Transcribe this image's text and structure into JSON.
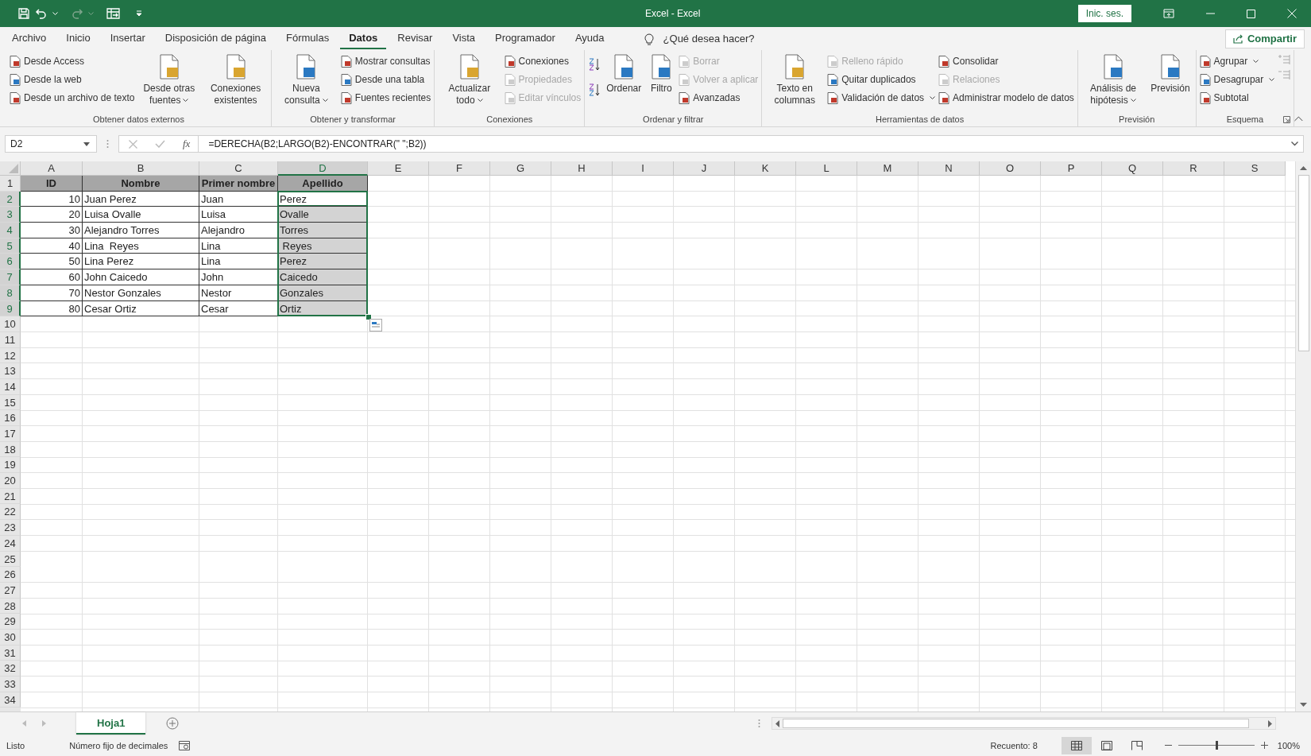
{
  "window": {
    "title": "Excel - Excel",
    "sign_in": "Inic. ses."
  },
  "menu_tabs": [
    {
      "label": "Archivo",
      "selected": false
    },
    {
      "label": "Inicio",
      "selected": false
    },
    {
      "label": "Insertar",
      "selected": false
    },
    {
      "label": "Disposición de página",
      "selected": false
    },
    {
      "label": "Fórmulas",
      "selected": false
    },
    {
      "label": "Datos",
      "selected": true
    },
    {
      "label": "Revisar",
      "selected": false
    },
    {
      "label": "Vista",
      "selected": false
    },
    {
      "label": "Programador",
      "selected": false
    },
    {
      "label": "Ayuda",
      "selected": false
    }
  ],
  "tell_me": "¿Qué desea hacer?",
  "share": "Compartir",
  "ribbon_groups": [
    {
      "label": "Obtener datos externos",
      "columns": [
        {
          "kind": "stack",
          "items": [
            {
              "label": "Desde Access",
              "disabled": false,
              "dropdown": false
            },
            {
              "label": "Desde la web",
              "disabled": false,
              "dropdown": false
            },
            {
              "label": "Desde un archivo de texto",
              "disabled": false,
              "dropdown": false
            }
          ]
        },
        {
          "kind": "large",
          "label": "Desde otras fuentes",
          "disabled": false,
          "dropdown": true
        },
        {
          "kind": "large",
          "label": "Conexiones existentes",
          "disabled": false,
          "dropdown": false
        }
      ]
    },
    {
      "label": "Obtener y transformar",
      "columns": [
        {
          "kind": "large",
          "label": "Nueva consulta",
          "disabled": false,
          "dropdown": true
        },
        {
          "kind": "stack",
          "items": [
            {
              "label": "Mostrar consultas",
              "disabled": false,
              "dropdown": false
            },
            {
              "label": "Desde una tabla",
              "disabled": false,
              "dropdown": false
            },
            {
              "label": "Fuentes recientes",
              "disabled": false,
              "dropdown": false
            }
          ]
        }
      ]
    },
    {
      "label": "Conexiones",
      "columns": [
        {
          "kind": "large",
          "label": "Actualizar todo",
          "disabled": false,
          "dropdown": true
        },
        {
          "kind": "stack",
          "items": [
            {
              "label": "Conexiones",
              "disabled": false,
              "dropdown": false
            },
            {
              "label": "Propiedades",
              "disabled": true,
              "dropdown": false
            },
            {
              "label": "Editar vínculos",
              "disabled": true,
              "dropdown": false
            }
          ]
        }
      ]
    },
    {
      "label": "Ordenar y filtrar",
      "columns": [
        {
          "kind": "sort"
        },
        {
          "kind": "large",
          "label": "Ordenar",
          "disabled": false,
          "dropdown": false
        },
        {
          "kind": "large",
          "label": "Filtro",
          "disabled": false,
          "dropdown": false
        },
        {
          "kind": "stack",
          "items": [
            {
              "label": "Borrar",
              "disabled": true,
              "dropdown": false
            },
            {
              "label": "Volver a aplicar",
              "disabled": true,
              "dropdown": false
            },
            {
              "label": "Avanzadas",
              "disabled": false,
              "dropdown": false
            }
          ]
        }
      ]
    },
    {
      "label": "Herramientas de datos",
      "columns": [
        {
          "kind": "large",
          "label": "Texto en columnas",
          "disabled": false,
          "dropdown": false
        },
        {
          "kind": "stack",
          "items": [
            {
              "label": "Relleno rápido",
              "disabled": true,
              "dropdown": false
            },
            {
              "label": "Quitar duplicados",
              "disabled": false,
              "dropdown": false
            },
            {
              "label": "Validación de datos",
              "disabled": false,
              "dropdown": true
            }
          ]
        },
        {
          "kind": "stack",
          "items": [
            {
              "label": "Consolidar",
              "disabled": false,
              "dropdown": false
            },
            {
              "label": "Relaciones",
              "disabled": true,
              "dropdown": false
            },
            {
              "label": "Administrar modelo de datos",
              "disabled": false,
              "dropdown": false
            }
          ]
        }
      ]
    },
    {
      "label": "Previsión",
      "columns": [
        {
          "kind": "large",
          "label": "Análisis de hipótesis",
          "disabled": false,
          "dropdown": true
        },
        {
          "kind": "large",
          "label": "Previsión",
          "disabled": false,
          "dropdown": false
        }
      ]
    },
    {
      "label": "Esquema",
      "launcher": true,
      "columns": [
        {
          "kind": "stack",
          "items": [
            {
              "label": "Agrupar",
              "disabled": false,
              "dropdown": true
            },
            {
              "label": "Desagrupar",
              "disabled": false,
              "dropdown": true
            },
            {
              "label": "Subtotal",
              "disabled": false,
              "dropdown": false
            }
          ]
        },
        {
          "kind": "outline"
        }
      ]
    }
  ],
  "formula_bar": {
    "name_box": "D2",
    "function_label": "fx",
    "formula": "=DERECHA(B2;LARGO(B2)-ENCONTRAR(\" \";B2))"
  },
  "grid": {
    "columns": [
      {
        "label": "A",
        "selected": false
      },
      {
        "label": "B",
        "selected": false
      },
      {
        "label": "C",
        "selected": false
      },
      {
        "label": "D",
        "selected": true
      },
      {
        "label": "E",
        "selected": false
      },
      {
        "label": "F",
        "selected": false
      },
      {
        "label": "G",
        "selected": false
      },
      {
        "label": "H",
        "selected": false
      },
      {
        "label": "I",
        "selected": false
      },
      {
        "label": "J",
        "selected": false
      },
      {
        "label": "K",
        "selected": false
      },
      {
        "label": "L",
        "selected": false
      },
      {
        "label": "M",
        "selected": false
      },
      {
        "label": "N",
        "selected": false
      },
      {
        "label": "O",
        "selected": false
      },
      {
        "label": "P",
        "selected": false
      },
      {
        "label": "Q",
        "selected": false
      },
      {
        "label": "R",
        "selected": false
      },
      {
        "label": "S",
        "selected": false
      }
    ],
    "row_numbers": [
      {
        "label": "1",
        "selected": false
      },
      {
        "label": "2",
        "selected": true
      },
      {
        "label": "3",
        "selected": true
      },
      {
        "label": "4",
        "selected": true
      },
      {
        "label": "5",
        "selected": true
      },
      {
        "label": "6",
        "selected": true
      },
      {
        "label": "7",
        "selected": true
      },
      {
        "label": "8",
        "selected": true
      },
      {
        "label": "9",
        "selected": true
      },
      {
        "label": "10",
        "selected": false
      },
      {
        "label": "11",
        "selected": false
      },
      {
        "label": "12",
        "selected": false
      },
      {
        "label": "13",
        "selected": false
      },
      {
        "label": "14",
        "selected": false
      },
      {
        "label": "15",
        "selected": false
      },
      {
        "label": "16",
        "selected": false
      },
      {
        "label": "17",
        "selected": false
      },
      {
        "label": "18",
        "selected": false
      },
      {
        "label": "19",
        "selected": false
      },
      {
        "label": "20",
        "selected": false
      },
      {
        "label": "21",
        "selected": false
      },
      {
        "label": "22",
        "selected": false
      },
      {
        "label": "23",
        "selected": false
      },
      {
        "label": "24",
        "selected": false
      },
      {
        "label": "25",
        "selected": false
      },
      {
        "label": "26",
        "selected": false
      },
      {
        "label": "27",
        "selected": false
      },
      {
        "label": "28",
        "selected": false
      },
      {
        "label": "29",
        "selected": false
      },
      {
        "label": "30",
        "selected": false
      },
      {
        "label": "31",
        "selected": false
      },
      {
        "label": "32",
        "selected": false
      },
      {
        "label": "33",
        "selected": false
      },
      {
        "label": "34",
        "selected": false
      }
    ],
    "rows": [
      {
        "kind": "header",
        "cells": [
          {
            "text": "ID",
            "selected": false,
            "active": false
          },
          {
            "text": "Nombre",
            "selected": false,
            "active": false
          },
          {
            "text": "Primer nombre",
            "selected": false,
            "active": false
          },
          {
            "text": "Apellido",
            "selected": false,
            "active": false
          }
        ]
      },
      {
        "kind": "data",
        "cells": [
          {
            "text": "10",
            "selected": false,
            "active": false
          },
          {
            "text": "Juan Perez",
            "selected": false,
            "active": false
          },
          {
            "text": "Juan",
            "selected": false,
            "active": false
          },
          {
            "text": "Perez",
            "selected": true,
            "active": true
          }
        ]
      },
      {
        "kind": "data",
        "cells": [
          {
            "text": "20",
            "selected": false,
            "active": false
          },
          {
            "text": "Luisa Ovalle",
            "selected": false,
            "active": false
          },
          {
            "text": "Luisa",
            "selected": false,
            "active": false
          },
          {
            "text": "Ovalle",
            "selected": true,
            "active": false
          }
        ]
      },
      {
        "kind": "data",
        "cells": [
          {
            "text": "30",
            "selected": false,
            "active": false
          },
          {
            "text": "Alejandro Torres",
            "selected": false,
            "active": false
          },
          {
            "text": "Alejandro",
            "selected": false,
            "active": false
          },
          {
            "text": "Torres",
            "selected": true,
            "active": false
          }
        ]
      },
      {
        "kind": "data",
        "cells": [
          {
            "text": "40",
            "selected": false,
            "active": false
          },
          {
            "text": "Lina  Reyes",
            "selected": false,
            "active": false
          },
          {
            "text": "Lina",
            "selected": false,
            "active": false
          },
          {
            "text": " Reyes",
            "selected": true,
            "active": false
          }
        ]
      },
      {
        "kind": "data",
        "cells": [
          {
            "text": "50",
            "selected": false,
            "active": false
          },
          {
            "text": "Lina Perez",
            "selected": false,
            "active": false
          },
          {
            "text": "Lina",
            "selected": false,
            "active": false
          },
          {
            "text": "Perez",
            "selected": true,
            "active": false
          }
        ]
      },
      {
        "kind": "data",
        "cells": [
          {
            "text": "60",
            "selected": false,
            "active": false
          },
          {
            "text": "John Caicedo",
            "selected": false,
            "active": false
          },
          {
            "text": "John",
            "selected": false,
            "active": false
          },
          {
            "text": "Caicedo",
            "selected": true,
            "active": false
          }
        ]
      },
      {
        "kind": "data",
        "cells": [
          {
            "text": "70",
            "selected": false,
            "active": false
          },
          {
            "text": "Nestor Gonzales",
            "selected": false,
            "active": false
          },
          {
            "text": "Nestor",
            "selected": false,
            "active": false
          },
          {
            "text": "Gonzales",
            "selected": true,
            "active": false
          }
        ]
      },
      {
        "kind": "data",
        "cells": [
          {
            "text": "80",
            "selected": false,
            "active": false
          },
          {
            "text": "Cesar Ortiz",
            "selected": false,
            "active": false
          },
          {
            "text": "Cesar",
            "selected": false,
            "active": false
          },
          {
            "text": "Ortiz",
            "selected": true,
            "active": false
          }
        ]
      }
    ]
  },
  "sheet_tabs": [
    {
      "label": "Hoja1",
      "selected": true
    }
  ],
  "status_bar": {
    "ready": "Listo",
    "mode": "Número fijo de decimales",
    "count": "Recuento: 8",
    "zoom": "100%",
    "zoom_level": {
      "level": 0.5
    }
  }
}
